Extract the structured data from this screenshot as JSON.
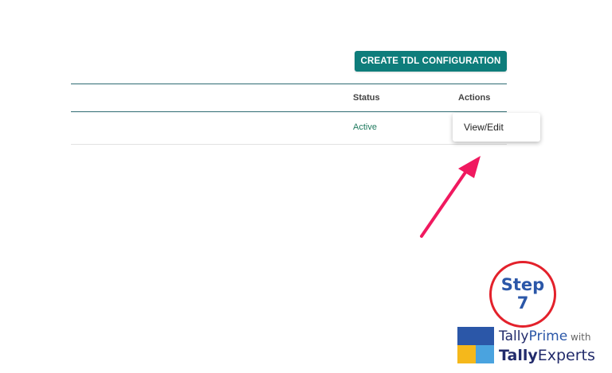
{
  "toolbar": {
    "create_label": "CREATE TDL CONFIGURATION"
  },
  "table": {
    "columns": {
      "status": "Status",
      "actions": "Actions"
    },
    "rows": [
      {
        "status": "Active"
      }
    ]
  },
  "menu": {
    "view_edit": "View/Edit"
  },
  "step": {
    "word": "Step",
    "number": "7"
  },
  "brand": {
    "part1": "Tally",
    "part2": "Prime",
    "with": " with",
    "part3": "Tally",
    "part4": "Experts"
  },
  "colors": {
    "accent": "#0e7d7b",
    "arrow": "#f0195f",
    "step_ring": "#e3212b",
    "step_text": "#2b57a8"
  },
  "icons": {
    "pointer": "arrow-pointer-icon",
    "logo": "tally-experts-logo"
  }
}
